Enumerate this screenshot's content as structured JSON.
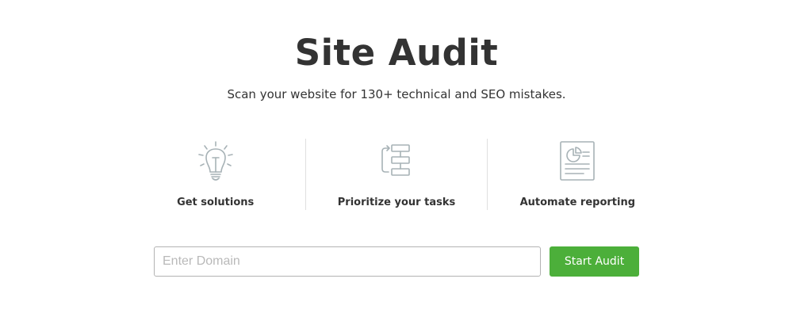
{
  "header": {
    "title": "Site Audit",
    "subtitle": "Scan your website for 130+ technical and SEO mistakes."
  },
  "features": [
    {
      "label": "Get solutions",
      "icon": "lightbulb-icon"
    },
    {
      "label": "Prioritize your tasks",
      "icon": "task-flow-icon"
    },
    {
      "label": "Automate reporting",
      "icon": "report-icon"
    }
  ],
  "form": {
    "domain_placeholder": "Enter Domain",
    "domain_value": "",
    "start_label": "Start Audit"
  },
  "colors": {
    "accent": "#4caf3a",
    "icon": "#a7b2b6",
    "text": "#333333"
  }
}
